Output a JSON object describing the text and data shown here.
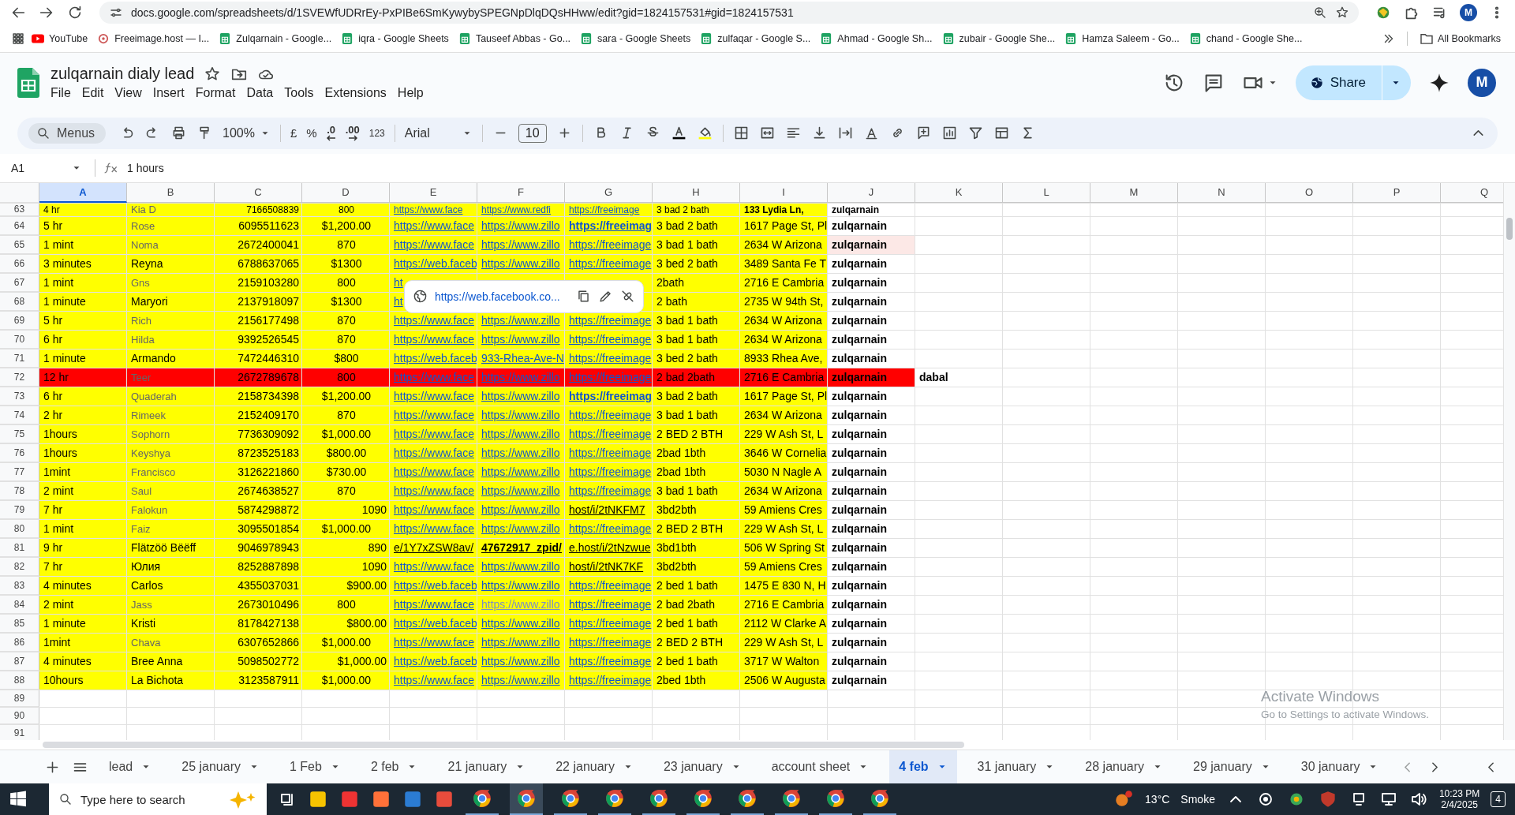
{
  "browser": {
    "url": "docs.google.com/spreadsheets/d/1SVEWfUDRrEy-PxPIBe6SmKywybySPEGNpDlqDQsHHww/edit?gid=1824157531#gid=1824157531",
    "profile": "M",
    "bookmarks": [
      {
        "label": "YouTube",
        "kind": "youtube"
      },
      {
        "label": "Freeimage.host — I...",
        "kind": "site"
      },
      {
        "label": "Zulqarnain - Google...",
        "kind": "sheets"
      },
      {
        "label": "iqra - Google Sheets",
        "kind": "sheets"
      },
      {
        "label": "Tauseef Abbas - Go...",
        "kind": "sheets"
      },
      {
        "label": "sara - Google Sheets",
        "kind": "sheets"
      },
      {
        "label": "zulfaqar - Google S...",
        "kind": "sheets"
      },
      {
        "label": "Ahmad - Google Sh...",
        "kind": "sheets"
      },
      {
        "label": "zubair - Google She...",
        "kind": "sheets"
      },
      {
        "label": "Hamza Saleem - Go...",
        "kind": "sheets"
      },
      {
        "label": "chand - Google She...",
        "kind": "sheets"
      }
    ],
    "all_bookmarks": "All Bookmarks"
  },
  "sheet": {
    "title": "zulqarnain dialy lead",
    "menu": [
      "File",
      "Edit",
      "View",
      "Insert",
      "Format",
      "Data",
      "Tools",
      "Extensions",
      "Help"
    ],
    "share": "Share",
    "avatar": "M"
  },
  "toolbar": {
    "search": "Menus",
    "zoom": "100%",
    "currency": "£",
    "percent": "%",
    "decrease_decimal": ".0",
    "increase_decimal": ".00",
    "number_format": "123",
    "font": "Arial",
    "font_size": "10"
  },
  "formula_bar": {
    "cell": "A1",
    "value": "1 hours"
  },
  "columns": [
    {
      "label": "A",
      "selected": true
    },
    {
      "label": "B",
      "selected": false
    },
    {
      "label": "C",
      "selected": false
    },
    {
      "label": "D",
      "selected": false
    },
    {
      "label": "E",
      "selected": false
    },
    {
      "label": "F",
      "selected": false
    },
    {
      "label": "G",
      "selected": false
    },
    {
      "label": "H",
      "selected": false
    },
    {
      "label": "I",
      "selected": false
    },
    {
      "label": "J",
      "selected": false
    },
    {
      "label": "K",
      "selected": false
    },
    {
      "label": "L",
      "selected": false
    },
    {
      "label": "M",
      "selected": false
    },
    {
      "label": "N",
      "selected": false
    },
    {
      "label": "O",
      "selected": false
    },
    {
      "label": "P",
      "selected": false
    },
    {
      "label": "Q",
      "selected": false
    }
  ],
  "rows": [
    {
      "number": "63",
      "color": "#ffff00",
      "cells": {
        "A": {
          "text": "4 hr"
        },
        "B": {
          "text": "Kia D",
          "kind": "muted"
        },
        "C": {
          "text": "7166508839",
          "kind": "number"
        },
        "D": {
          "text": "800",
          "kind": "amount"
        },
        "E": {
          "text": "https://www.face",
          "kind": "link"
        },
        "F": {
          "text": "https://www.redfi",
          "kind": "link"
        },
        "G": {
          "text": "https://freeimage",
          "kind": "link"
        },
        "H": {
          "text": "3 bad 2 bath"
        },
        "I": {
          "text": "133 Lydia Ln,",
          "kind": "bold"
        },
        "J": {
          "text": "zulqarnain",
          "kind": "bold"
        }
      }
    },
    {
      "number": "64",
      "color": "#ffff00",
      "cells": {
        "A": {
          "text": "5 hr"
        },
        "B": {
          "text": "Rose",
          "kind": "muted"
        },
        "C": {
          "text": "6095511623",
          "kind": "number"
        },
        "D": {
          "text": "$1,200.00",
          "kind": "amount"
        },
        "E": {
          "text": "https://www.face",
          "kind": "link"
        },
        "F": {
          "text": "https://www.zillo",
          "kind": "link"
        },
        "G": {
          "text": "https://freeimag",
          "kind": "link-bold"
        },
        "H": {
          "text": "3 bad 2 bath"
        },
        "I": {
          "text": "1617 Page St, Pl"
        },
        "J": {
          "text": "zulqarnain",
          "kind": "bold"
        }
      }
    },
    {
      "number": "65",
      "color": "#ffff00",
      "cells": {
        "A": {
          "text": "1 mint"
        },
        "B": {
          "text": "Noma",
          "kind": "muted"
        },
        "C": {
          "text": "2672400041",
          "kind": "number"
        },
        "D": {
          "text": "870",
          "kind": "amount"
        },
        "E": {
          "text": "https://www.face",
          "kind": "link"
        },
        "F": {
          "text": "https://www.zillo",
          "kind": "link"
        },
        "G": {
          "text": "https://freeimage",
          "kind": "link"
        },
        "H": {
          "text": "3 bad 1 bath"
        },
        "I": {
          "text": "2634 W Arizona"
        },
        "J": {
          "text": "zulqarnain",
          "kind": "bold",
          "color": "#fce8e6"
        }
      }
    },
    {
      "number": "66",
      "color": "#ffff00",
      "cells": {
        "A": {
          "text": "3 minutes"
        },
        "B": {
          "text": "Reyna"
        },
        "C": {
          "text": "6788637065",
          "kind": "number"
        },
        "D": {
          "text": "$1300",
          "kind": "amount"
        },
        "E": {
          "text": "https://web.faceb",
          "kind": "link"
        },
        "F": {
          "text": "https://www.zillo",
          "kind": "link"
        },
        "G": {
          "text": "https://freeimage",
          "kind": "link"
        },
        "H": {
          "text": "3 bed 2 bath"
        },
        "I": {
          "text": "3489 Santa Fe T"
        },
        "J": {
          "text": "zulqarnain",
          "kind": "bold"
        }
      }
    },
    {
      "number": "67",
      "color": "#ffff00",
      "cells": {
        "A": {
          "text": "1 mint"
        },
        "B": {
          "text": "Gns",
          "kind": "muted"
        },
        "C": {
          "text": "2159103280",
          "kind": "number"
        },
        "D": {
          "text": "800",
          "kind": "amount"
        },
        "E": {
          "text": "ht",
          "kind": "link"
        },
        "H": {
          "text": "2bath"
        },
        "I": {
          "text": "2716 E Cambria"
        },
        "J": {
          "text": "zulqarnain",
          "kind": "bold"
        }
      }
    },
    {
      "number": "68",
      "color": "#ffff00",
      "cells": {
        "A": {
          "text": "1 minute"
        },
        "B": {
          "text": "Maryori"
        },
        "C": {
          "text": "2137918097",
          "kind": "number"
        },
        "D": {
          "text": "$1300",
          "kind": "amount"
        },
        "E": {
          "text": "ht",
          "kind": "link"
        },
        "H": {
          "text": "2 bath"
        },
        "I": {
          "text": "2735 W 94th St,"
        },
        "J": {
          "text": "zulqarnain",
          "kind": "bold"
        }
      }
    },
    {
      "number": "69",
      "color": "#ffff00",
      "cells": {
        "A": {
          "text": "5 hr"
        },
        "B": {
          "text": "Rich",
          "kind": "muted"
        },
        "C": {
          "text": "2156177498",
          "kind": "number"
        },
        "D": {
          "text": "870",
          "kind": "amount"
        },
        "E": {
          "text": "https://www.face",
          "kind": "link"
        },
        "F": {
          "text": "https://www.zillo",
          "kind": "link"
        },
        "G": {
          "text": "https://freeimage",
          "kind": "link"
        },
        "H": {
          "text": "3 bad 1 bath"
        },
        "I": {
          "text": "2634 W Arizona"
        },
        "J": {
          "text": "zulqarnain",
          "kind": "bold"
        }
      }
    },
    {
      "number": "70",
      "color": "#ffff00",
      "cells": {
        "A": {
          "text": "6 hr"
        },
        "B": {
          "text": "Hilda",
          "kind": "muted"
        },
        "C": {
          "text": "9392526545",
          "kind": "number"
        },
        "D": {
          "text": "870",
          "kind": "amount"
        },
        "E": {
          "text": "https://www.face",
          "kind": "link"
        },
        "F": {
          "text": "https://www.zillo",
          "kind": "link"
        },
        "G": {
          "text": "https://freeimage",
          "kind": "link"
        },
        "H": {
          "text": "3 bad 1 bath"
        },
        "I": {
          "text": "2634 W Arizona"
        },
        "J": {
          "text": "zulqarnain",
          "kind": "bold"
        }
      }
    },
    {
      "number": "71",
      "color": "#ffff00",
      "cells": {
        "A": {
          "text": "1 minute"
        },
        "B": {
          "text": "Armando"
        },
        "C": {
          "text": "7472446310",
          "kind": "number"
        },
        "D": {
          "text": "$800",
          "kind": "amount"
        },
        "E": {
          "text": "https://web.faceb",
          "kind": "link"
        },
        "F": {
          "text": "933-Rhea-Ave-N",
          "kind": "link"
        },
        "G": {
          "text": "https://freeimage",
          "kind": "link"
        },
        "H": {
          "text": "3 bed 2 bath"
        },
        "I": {
          "text": "8933 Rhea Ave,"
        },
        "J": {
          "text": "zulqarnain",
          "kind": "bold"
        }
      }
    },
    {
      "number": "72",
      "color": "#ff0000",
      "cells": {
        "A": {
          "text": "12 hr"
        },
        "B": {
          "text": "Teer",
          "kind": "muted"
        },
        "C": {
          "text": "2672789678",
          "kind": "number"
        },
        "D": {
          "text": "800",
          "kind": "amount"
        },
        "E": {
          "text": "https://www.face",
          "kind": "link"
        },
        "F": {
          "text": "https://www.zillo",
          "kind": "link"
        },
        "G": {
          "text": "https://freeimage",
          "kind": "link"
        },
        "H": {
          "text": "2 bad 2bath"
        },
        "I": {
          "text": "2716 E Cambria"
        },
        "J": {
          "text": "zulqarnain",
          "kind": "bold",
          "color": "#ff0000"
        },
        "K": {
          "text": "dabal",
          "kind": "bold"
        }
      }
    },
    {
      "number": "73",
      "color": "#ffff00",
      "cells": {
        "A": {
          "text": "6 hr"
        },
        "B": {
          "text": "Quaderah",
          "kind": "muted"
        },
        "C": {
          "text": "2158734398",
          "kind": "number"
        },
        "D": {
          "text": "$1,200.00",
          "kind": "amount"
        },
        "E": {
          "text": "https://www.face",
          "kind": "link"
        },
        "F": {
          "text": "https://www.zillo",
          "kind": "link"
        },
        "G": {
          "text": "https://freeimag",
          "kind": "link-bold"
        },
        "H": {
          "text": "3 bad 2 bath"
        },
        "I": {
          "text": "1617 Page St, Pl"
        },
        "J": {
          "text": "zulqarnain",
          "kind": "bold"
        }
      }
    },
    {
      "number": "74",
      "color": "#ffff00",
      "cells": {
        "A": {
          "text": "2 hr"
        },
        "B": {
          "text": "Rimeek",
          "kind": "muted"
        },
        "C": {
          "text": "2152409170",
          "kind": "number"
        },
        "D": {
          "text": "870",
          "kind": "amount"
        },
        "E": {
          "text": "https://www.face",
          "kind": "link"
        },
        "F": {
          "text": "https://www.zillo",
          "kind": "link"
        },
        "G": {
          "text": "https://freeimage",
          "kind": "link"
        },
        "H": {
          "text": "3 bad 1 bath"
        },
        "I": {
          "text": "2634 W Arizona"
        },
        "J": {
          "text": "zulqarnain",
          "kind": "bold"
        }
      }
    },
    {
      "number": "75",
      "color": "#ffff00",
      "cells": {
        "A": {
          "text": "1hours"
        },
        "B": {
          "text": "Sophorn",
          "kind": "muted"
        },
        "C": {
          "text": "7736309092",
          "kind": "number"
        },
        "D": {
          "text": "$1,000.00",
          "kind": "amount"
        },
        "E": {
          "text": "https://www.face",
          "kind": "link"
        },
        "F": {
          "text": "https://www.zillo",
          "kind": "link"
        },
        "G": {
          "text": "https://freeimage",
          "kind": "link"
        },
        "H": {
          "text": "2 BED 2 BTH"
        },
        "I": {
          "text": "229 W Ash St, L"
        },
        "J": {
          "text": "zulqarnain",
          "kind": "bold"
        }
      }
    },
    {
      "number": "76",
      "color": "#ffff00",
      "cells": {
        "A": {
          "text": "1hours"
        },
        "B": {
          "text": "Keyshya",
          "kind": "muted"
        },
        "C": {
          "text": "8723525183",
          "kind": "number"
        },
        "D": {
          "text": "$800.00",
          "kind": "amount"
        },
        "E": {
          "text": "https://www.face",
          "kind": "link"
        },
        "F": {
          "text": "https://www.zillo",
          "kind": "link"
        },
        "G": {
          "text": "https://freeimage",
          "kind": "link"
        },
        "H": {
          "text": "2bad  1bth"
        },
        "I": {
          "text": "3646 W Cornelia"
        },
        "J": {
          "text": "zulqarnain",
          "kind": "bold"
        }
      }
    },
    {
      "number": "77",
      "color": "#ffff00",
      "cells": {
        "A": {
          "text": "1mint"
        },
        "B": {
          "text": "Francisco",
          "kind": "muted"
        },
        "C": {
          "text": "3126221860",
          "kind": "number"
        },
        "D": {
          "text": "$730.00",
          "kind": "amount"
        },
        "E": {
          "text": "https://www.face",
          "kind": "link"
        },
        "F": {
          "text": "https://www.zillo",
          "kind": "link"
        },
        "G": {
          "text": "https://freeimage",
          "kind": "link"
        },
        "H": {
          "text": "2bad 1bth"
        },
        "I": {
          "text": "5030 N Nagle A"
        },
        "J": {
          "text": "zulqarnain",
          "kind": "bold"
        }
      }
    },
    {
      "number": "78",
      "color": "#ffff00",
      "cells": {
        "A": {
          "text": "2 mint"
        },
        "B": {
          "text": "Saul",
          "kind": "muted"
        },
        "C": {
          "text": "2674638527",
          "kind": "number"
        },
        "D": {
          "text": "870",
          "kind": "amount"
        },
        "E": {
          "text": "https://www.face",
          "kind": "link"
        },
        "F": {
          "text": "https://www.zillo",
          "kind": "link"
        },
        "G": {
          "text": "https://freeimage",
          "kind": "link"
        },
        "H": {
          "text": "3 bad 1 bath"
        },
        "I": {
          "text": "2634 W Arizona"
        },
        "J": {
          "text": "zulqarnain",
          "kind": "bold"
        }
      }
    },
    {
      "number": "79",
      "color": "#ffff00",
      "cells": {
        "A": {
          "text": "7 hr"
        },
        "B": {
          "text": "Falokun",
          "kind": "muted"
        },
        "C": {
          "text": "5874298872",
          "kind": "number"
        },
        "D": {
          "text": "1090",
          "kind": "number"
        },
        "E": {
          "text": "https://www.face",
          "kind": "link"
        },
        "F": {
          "text": "https://www.zillo",
          "kind": "link"
        },
        "G": {
          "text": "host/i/2tNKFM7",
          "kind": "underlined"
        },
        "H": {
          "text": "3bd2bth"
        },
        "I": {
          "text": "59 Amiens Cres"
        },
        "J": {
          "text": "zulqarnain",
          "kind": "bold"
        }
      }
    },
    {
      "number": "80",
      "color": "#ffff00",
      "cells": {
        "A": {
          "text": "1 mint"
        },
        "B": {
          "text": "Faiz",
          "kind": "muted"
        },
        "C": {
          "text": "3095501854",
          "kind": "number"
        },
        "D": {
          "text": "$1,000.00",
          "kind": "amount"
        },
        "E": {
          "text": "https://www.face",
          "kind": "link"
        },
        "F": {
          "text": "https://www.zillo",
          "kind": "link"
        },
        "G": {
          "text": "https://freeimage",
          "kind": "link"
        },
        "H": {
          "text": "2 BED 2 BTH"
        },
        "I": {
          "text": "229 W Ash St, L"
        },
        "J": {
          "text": "zulqarnain",
          "kind": "bold"
        }
      }
    },
    {
      "number": "81",
      "color": "#ffff00",
      "cells": {
        "A": {
          "text": "9 hr"
        },
        "B": {
          "text": "Flätzöö Bëëff"
        },
        "C": {
          "text": "9046978943",
          "kind": "number"
        },
        "D": {
          "text": "890",
          "kind": "number"
        },
        "E": {
          "text": "e/1Y7xZSW8av/",
          "kind": "underlined"
        },
        "F": {
          "text": "47672917_zpid/",
          "kind": "underlined-bold"
        },
        "G": {
          "text": "e.host/i/2tNzwue",
          "kind": "underlined"
        },
        "H": {
          "text": "3bd1bth"
        },
        "I": {
          "text": "506 W Spring St"
        },
        "J": {
          "text": "zulqarnain",
          "kind": "bold"
        }
      }
    },
    {
      "number": "82",
      "color": "#ffff00",
      "cells": {
        "A": {
          "text": "7 hr"
        },
        "B": {
          "text": "Юлия"
        },
        "C": {
          "text": "8252887898",
          "kind": "number"
        },
        "D": {
          "text": "1090",
          "kind": "number"
        },
        "E": {
          "text": "https://www.face",
          "kind": "link"
        },
        "F": {
          "text": "https://www.zillo",
          "kind": "link"
        },
        "G": {
          "text": "host/i/2tNK7KF",
          "kind": "underlined"
        },
        "H": {
          "text": "3bd2bth"
        },
        "I": {
          "text": "59 Amiens Cres"
        },
        "J": {
          "text": "zulqarnain",
          "kind": "bold"
        }
      }
    },
    {
      "number": "83",
      "color": "#ffff00",
      "cells": {
        "A": {
          "text": "4 minutes"
        },
        "B": {
          "text": "Carlos"
        },
        "C": {
          "text": "4355037031",
          "kind": "number"
        },
        "D": {
          "text": "$900.00",
          "kind": "number"
        },
        "E": {
          "text": "https://web.faceb",
          "kind": "link"
        },
        "F": {
          "text": "https://www.zillo",
          "kind": "link"
        },
        "G": {
          "text": "https://freeimage",
          "kind": "link"
        },
        "H": {
          "text": "2 bed 1 bath"
        },
        "I": {
          "text": "1475 E 830 N, H"
        },
        "J": {
          "text": "zulqarnain",
          "kind": "bold"
        }
      }
    },
    {
      "number": "84",
      "color": "#ffff00",
      "cells": {
        "A": {
          "text": "2 mint"
        },
        "B": {
          "text": "Jass",
          "kind": "muted"
        },
        "C": {
          "text": "2673010496",
          "kind": "number"
        },
        "D": {
          "text": "800",
          "kind": "amount"
        },
        "E": {
          "text": "https://www.face",
          "kind": "link"
        },
        "F": {
          "text": "https://www.zillo",
          "kind": "link-faded"
        },
        "G": {
          "text": "https://freeimage",
          "kind": "link"
        },
        "H": {
          "text": "2 bad 2bath"
        },
        "I": {
          "text": "2716 E Cambria"
        },
        "J": {
          "text": "zulqarnain",
          "kind": "bold"
        }
      }
    },
    {
      "number": "85",
      "color": "#ffff00",
      "cells": {
        "A": {
          "text": "1 minute"
        },
        "B": {
          "text": "Kristi"
        },
        "C": {
          "text": "8178427138",
          "kind": "number"
        },
        "D": {
          "text": "$800.00",
          "kind": "number"
        },
        "E": {
          "text": "https://web.faceb",
          "kind": "link"
        },
        "F": {
          "text": "https://www.zillo",
          "kind": "link"
        },
        "G": {
          "text": "https://freeimage",
          "kind": "link"
        },
        "H": {
          "text": "2 bed 1 bath"
        },
        "I": {
          "text": "2112 W Clarke A"
        },
        "J": {
          "text": "zulqarnain",
          "kind": "bold"
        }
      }
    },
    {
      "number": "86",
      "color": "#ffff00",
      "cells": {
        "A": {
          "text": "1mint"
        },
        "B": {
          "text": "Chava",
          "kind": "muted"
        },
        "C": {
          "text": "6307652866",
          "kind": "number"
        },
        "D": {
          "text": "$1,000.00",
          "kind": "amount"
        },
        "E": {
          "text": "https://www.face",
          "kind": "link"
        },
        "F": {
          "text": "https://www.zillo",
          "kind": "link"
        },
        "G": {
          "text": "https://freeimage",
          "kind": "link"
        },
        "H": {
          "text": "2 BED 2 BTH"
        },
        "I": {
          "text": "229 W Ash St, L"
        },
        "J": {
          "text": "zulqarnain",
          "kind": "bold"
        }
      }
    },
    {
      "number": "87",
      "color": "#ffff00",
      "cells": {
        "A": {
          "text": "4 minutes"
        },
        "B": {
          "text": "Bree Anna"
        },
        "C": {
          "text": "5098502772",
          "kind": "number"
        },
        "D": {
          "text": "$1,000.00",
          "kind": "number"
        },
        "E": {
          "text": "https://web.faceb",
          "kind": "link"
        },
        "F": {
          "text": "https://www.zillo",
          "kind": "link"
        },
        "G": {
          "text": "https://freeimage",
          "kind": "link"
        },
        "H": {
          "text": "2 bed 1 bath"
        },
        "I": {
          "text": "3717 W Walton"
        },
        "J": {
          "text": "zulqarnain",
          "kind": "bold"
        }
      }
    },
    {
      "number": "88",
      "color": "#ffff00",
      "cells": {
        "A": {
          "text": "10hours"
        },
        "B": {
          "text": "La Bichota"
        },
        "C": {
          "text": "3123587911",
          "kind": "number"
        },
        "D": {
          "text": "$1,000.00",
          "kind": "amount"
        },
        "E": {
          "text": "https://www.face",
          "kind": "link"
        },
        "F": {
          "text": "https://www.zillo",
          "kind": "link"
        },
        "G": {
          "text": "https://freeimage",
          "kind": "link"
        },
        "H": {
          "text": "2bed 1bth"
        },
        "I": {
          "text": "2506 W Augusta"
        },
        "J": {
          "text": "zulqarnain",
          "kind": "bold"
        }
      }
    },
    {
      "number": "89"
    },
    {
      "number": "90"
    },
    {
      "number": "91"
    }
  ],
  "link_popup": {
    "url": "https://web.facebook.co..."
  },
  "os_notice": {
    "title": "Activate Windows",
    "subtitle": "Go to Settings to activate Windows."
  },
  "tabs": [
    {
      "label": "lead",
      "selected": false
    },
    {
      "label": "25 january",
      "selected": false
    },
    {
      "label": "1 Feb",
      "selected": false
    },
    {
      "label": "2 feb",
      "selected": false
    },
    {
      "label": "21 january",
      "selected": false
    },
    {
      "label": "22 january",
      "selected": false
    },
    {
      "label": "23 january",
      "selected": false
    },
    {
      "label": "account sheet",
      "selected": false
    },
    {
      "label": "4 feb",
      "selected": true
    },
    {
      "label": "31 january",
      "selected": false
    },
    {
      "label": "28 january",
      "selected": false
    },
    {
      "label": "29 january",
      "selected": false
    },
    {
      "label": "30 january",
      "selected": false
    }
  ],
  "taskbar": {
    "search_placeholder": "Type here to search",
    "temperature": "13°C",
    "weather": "Smoke",
    "time": "10:23 PM",
    "date": "2/4/2025",
    "notifications": "4"
  }
}
